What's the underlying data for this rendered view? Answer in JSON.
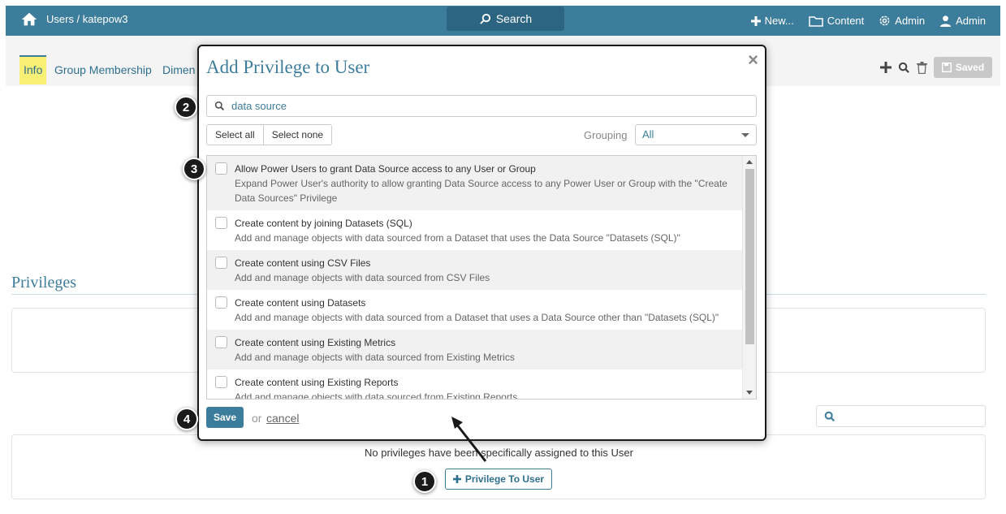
{
  "header": {
    "breadcrumb": "Users / katepow3",
    "search_label": "Search",
    "new_label": "New...",
    "content_label": "Content",
    "admin_label": "Admin",
    "user_label": "Admin"
  },
  "tabs": {
    "info": "Info",
    "group_membership": "Group Membership",
    "dimensions": "Dimen"
  },
  "toolbar": {
    "saved_label": "Saved"
  },
  "privileges": {
    "title": "Privileges",
    "empty_message": "No privileges have been specifically assigned to this User",
    "add_button_label": "Privilege To User"
  },
  "modal": {
    "title": "Add Privilege to User",
    "close_glyph": "×",
    "search_value": "data source",
    "select_all": "Select all",
    "select_none": "Select none",
    "grouping_label": "Grouping",
    "grouping_value": "All",
    "items": [
      {
        "title": "Allow Power Users to grant Data Source access to any User or Group",
        "desc": "Expand Power User's authority to allow granting Data Source access to any Power User or Group with the \"Create Data Sources\" Privilege"
      },
      {
        "title": "Create content by joining Datasets (SQL)",
        "desc": "Add and manage objects with data sourced from a Dataset that uses the Data Source \"Datasets (SQL)\""
      },
      {
        "title": "Create content using CSV Files",
        "desc": "Add and manage objects with data sourced from CSV Files"
      },
      {
        "title": "Create content using Datasets",
        "desc": "Add and manage objects with data sourced from a Dataset that uses a Data Source other than \"Datasets (SQL)\""
      },
      {
        "title": "Create content using Existing Metrics",
        "desc": "Add and manage objects with data sourced from Existing Metrics"
      },
      {
        "title": "Create content using Existing Reports",
        "desc": "Add and manage objects with data sourced from Existing Reports"
      }
    ],
    "save_label": "Save",
    "or_text": "or",
    "cancel_label": "cancel"
  },
  "callouts": [
    "1",
    "2",
    "3",
    "4"
  ],
  "colors": {
    "brand": "#3d7d9c",
    "highlight": "#f8ef75"
  }
}
